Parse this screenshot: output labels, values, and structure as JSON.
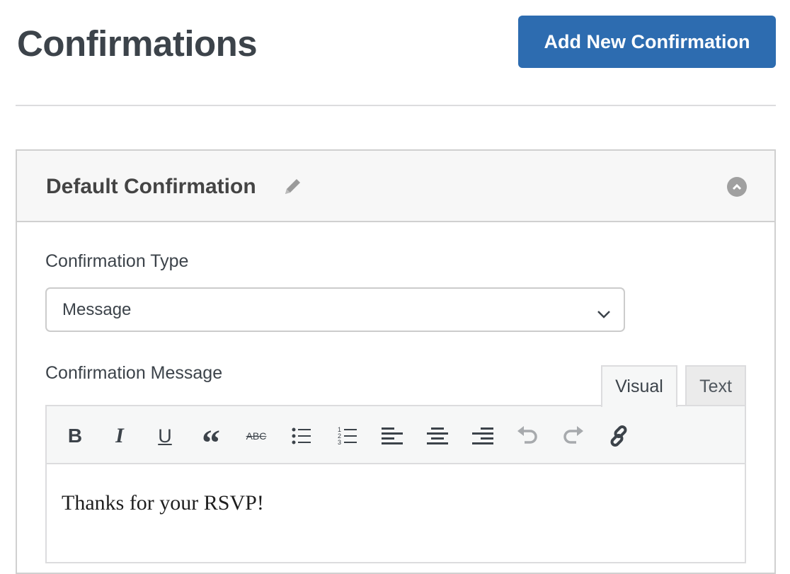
{
  "page": {
    "title": "Confirmations",
    "add_button": "Add New Confirmation"
  },
  "panel": {
    "title": "Default Confirmation",
    "edit_icon": "pencil-icon",
    "collapse_icon": "chevron-up-circle-icon",
    "type_label": "Confirmation Type",
    "type_value": "Message",
    "message_label": "Confirmation Message",
    "tabs": [
      {
        "label": "Visual",
        "active": true
      },
      {
        "label": "Text",
        "active": false
      }
    ],
    "toolbar": [
      "bold",
      "italic",
      "underline",
      "blockquote",
      "strikethrough",
      "bulleted-list",
      "numbered-list",
      "align-left",
      "align-center",
      "align-right",
      "undo",
      "redo",
      "link"
    ],
    "message": "Thanks for your RSVP!"
  },
  "colors": {
    "accent": "#2d6cb0"
  }
}
